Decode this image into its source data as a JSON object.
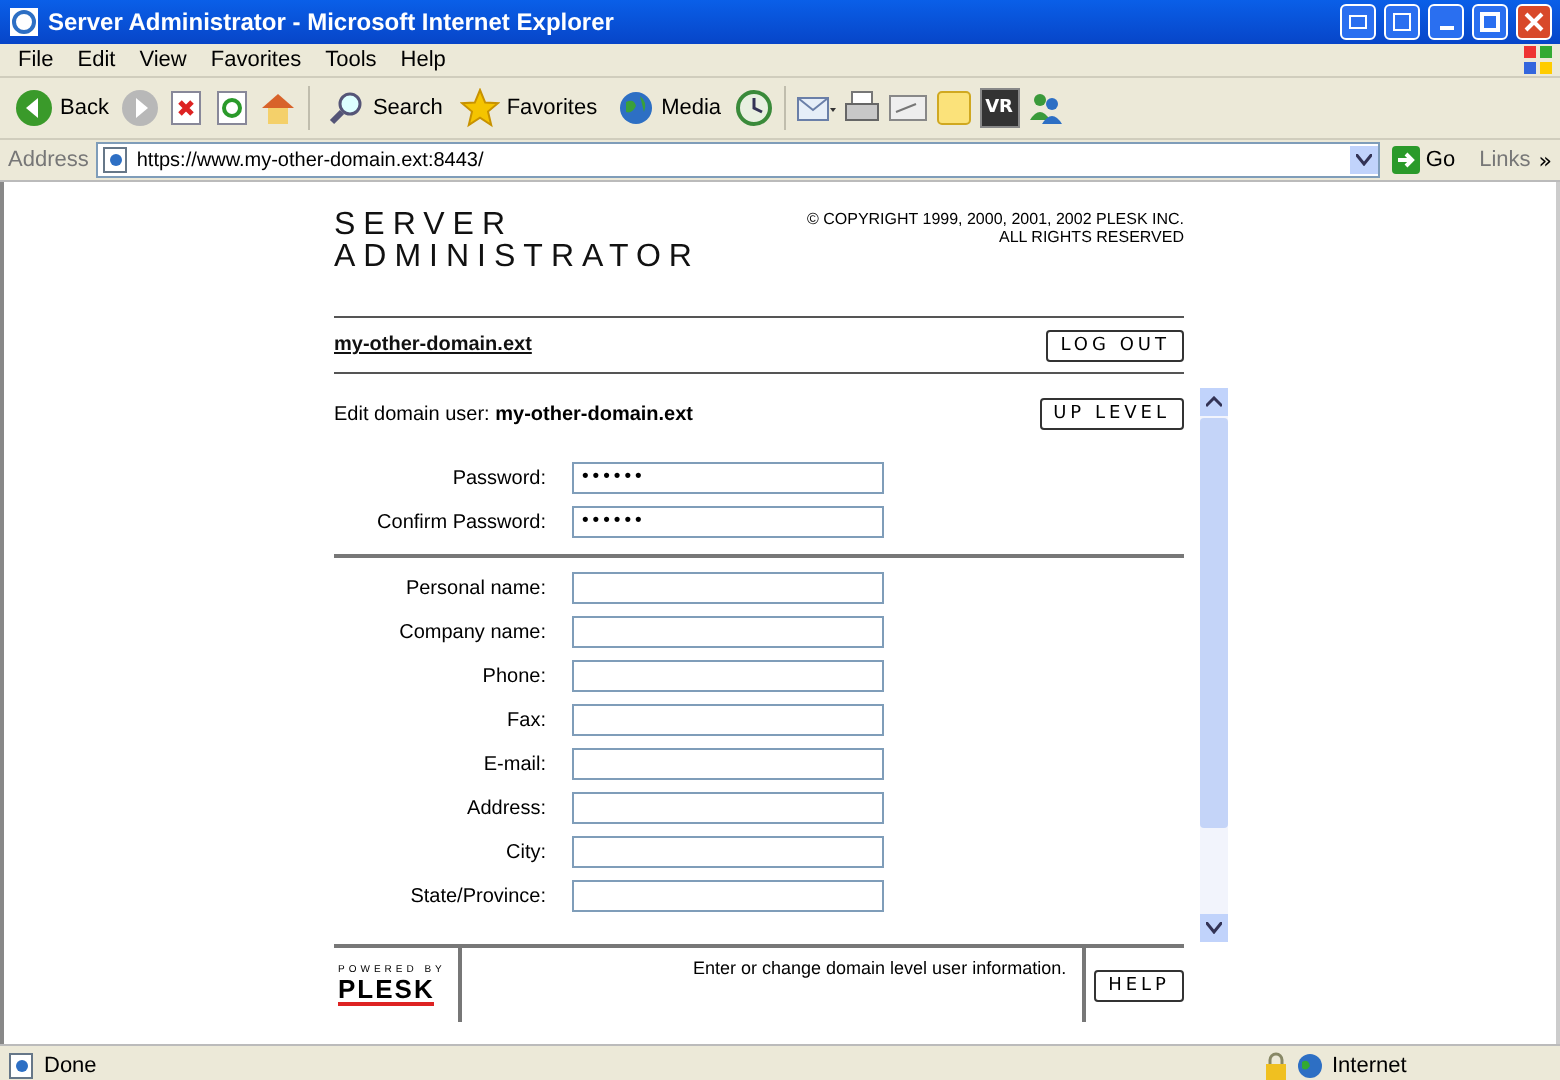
{
  "window": {
    "title": "Server Administrator - Microsoft Internet Explorer"
  },
  "menu": [
    "File",
    "Edit",
    "View",
    "Favorites",
    "Tools",
    "Help"
  ],
  "toolbar": [
    {
      "kind": "back",
      "label": "Back"
    },
    {
      "kind": "forward"
    },
    {
      "kind": "stop"
    },
    {
      "kind": "refresh"
    },
    {
      "kind": "home"
    },
    {
      "kind": "search",
      "label": "Search"
    },
    {
      "kind": "favorites",
      "label": "Favorites"
    },
    {
      "kind": "media",
      "label": "Media"
    },
    {
      "kind": "history"
    },
    {
      "kind": "mail"
    },
    {
      "kind": "print"
    },
    {
      "kind": "edit"
    },
    {
      "kind": "note"
    },
    {
      "kind": "vr",
      "label": "VR"
    },
    {
      "kind": "messenger"
    }
  ],
  "address": {
    "label": "Address",
    "url": "https://www.my-other-domain.ext:8443/",
    "go": "Go",
    "links": "Links",
    "more": "»"
  },
  "page": {
    "logo_lines": [
      "SERVER",
      "ADMINISTRATOR"
    ],
    "copyright": [
      "© COPYRIGHT 1999, 2000, 2001, 2002 PLESK INC.",
      "ALL RIGHTS RESERVED"
    ],
    "domain_link": "my-other-domain.ext",
    "logout": "LOG OUT",
    "heading": "Edit domain user: **my-other-domain.ext**",
    "up_level": "UP LEVEL",
    "password_fields": [
      {
        "label": "Password:",
        "value": "••••••"
      },
      {
        "label": "Confirm Password:",
        "value": "••••••"
      }
    ],
    "contact_fields": [
      {
        "label": "Personal name:"
      },
      {
        "label": "Company name:"
      },
      {
        "label": "Phone:"
      },
      {
        "label": "Fax:"
      },
      {
        "label": "E-mail:"
      },
      {
        "label": "Address:"
      },
      {
        "label": "City:"
      },
      {
        "label": "State/Province:"
      }
    ],
    "footer": {
      "powered_by": "POWERED BY",
      "brand": "PLESK",
      "hint": "Enter or change domain level user information.",
      "help": "HELP"
    }
  },
  "status_bar": {
    "text": "Done",
    "zone": "Internet"
  }
}
